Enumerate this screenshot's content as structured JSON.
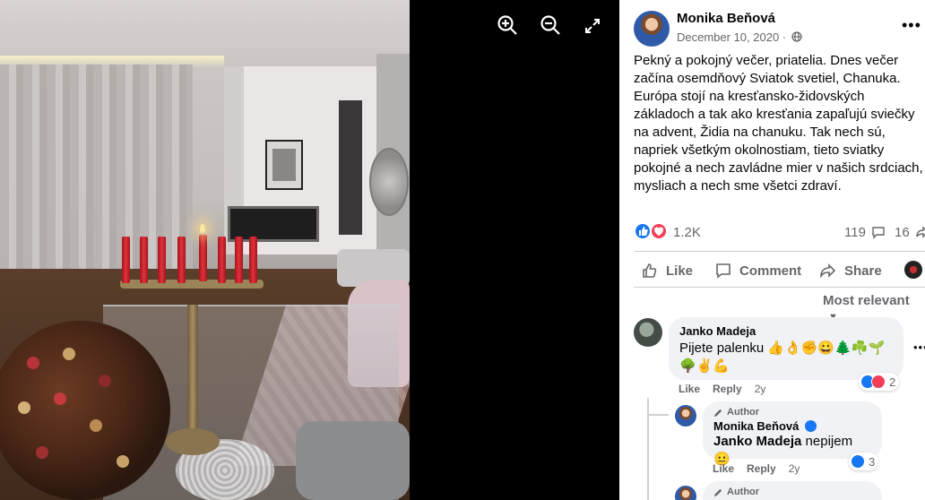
{
  "viewer": {
    "zoom_in_icon": "zoom-in-icon",
    "zoom_out_icon": "zoom-out-icon",
    "fullscreen_icon": "expand-icon"
  },
  "post": {
    "author": "Monika Beňová",
    "date": "December 10, 2020 ·",
    "text": "Pekný a pokojný večer, priatelia. Dnes večer\nzačína osemdňový Sviatok svetiel, Chanuka.\nEurópa stojí na kresťansko-židovských\nzákladoch a tak ako kresťania zapaľujú sviečky\nna advent, Židia na chanuku. Tak nech sú,\nnapriek všetkým okolnostiam, tieto sviatky\npokojné a nech zavládne mier v našich srdciach,\nmysliach a nech sme všetci zdraví.",
    "reaction_count": "1.2K",
    "comment_count": "119",
    "share_count": "16"
  },
  "actions": {
    "like": "Like",
    "comment": "Comment",
    "share": "Share"
  },
  "sort_label": "Most relevant",
  "comments": [
    {
      "name": "Janko Madeja",
      "text_line1": "Pijete palenku 👍👌✊😀🌲☘️🌱",
      "text_line2": "🌳✌️💪",
      "like": "Like",
      "reply": "Reply",
      "time": "2y",
      "reactions": "2"
    }
  ],
  "replies": [
    {
      "badge": "Author",
      "name": "Monika Beňová",
      "mention": "Janko Madeja",
      "text": " nepijem 😐",
      "like": "Like",
      "reply": "Reply",
      "time": "2y",
      "reactions": "3"
    },
    {
      "badge": "Author"
    }
  ],
  "colors": {
    "like_blue": "#1877f2",
    "love_red": "#f33e58",
    "secondary_text": "#65676b"
  }
}
